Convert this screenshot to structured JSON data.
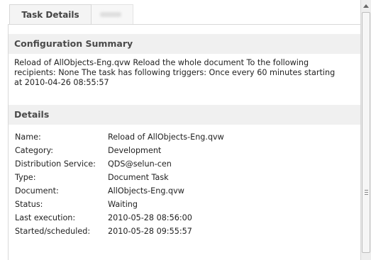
{
  "tabs": [
    {
      "label": "Task Details",
      "active": true
    },
    {
      "label": "",
      "active": false
    }
  ],
  "configuration_summary": {
    "title": "Configuration Summary",
    "lines": [
      "Reload of AllObjects-Eng.qvw  Reload the whole document To the following",
      "recipients: None The task has following triggers: Once every 60 minutes starting",
      "at 2010-04-26 08:55:57"
    ]
  },
  "details": {
    "title": "Details",
    "rows": [
      {
        "key": "Name:",
        "value": "Reload of AllObjects-Eng.qvw"
      },
      {
        "key": "Category:",
        "value": "Development"
      },
      {
        "key": "Distribution Service:",
        "value": "QDS@selun-cen"
      },
      {
        "key": "Type:",
        "value": "Document Task"
      },
      {
        "key": "Document:",
        "value": "AllObjects-Eng.qvw"
      },
      {
        "key": "Status:",
        "value": "Waiting"
      },
      {
        "key": "Last execution:",
        "value": "2010-05-28 08:56:00"
      },
      {
        "key": "Started/scheduled:",
        "value": "2010-05-28 09:55:57"
      }
    ]
  },
  "icons": {
    "scroll_up": "triangle-up-icon",
    "thumb_grip": "grip-lines-icon"
  },
  "colors": {
    "header_bg": "#f0f0f0",
    "header_text": "#4a4a4a",
    "text": "#222222",
    "border": "#d9d9d9"
  }
}
